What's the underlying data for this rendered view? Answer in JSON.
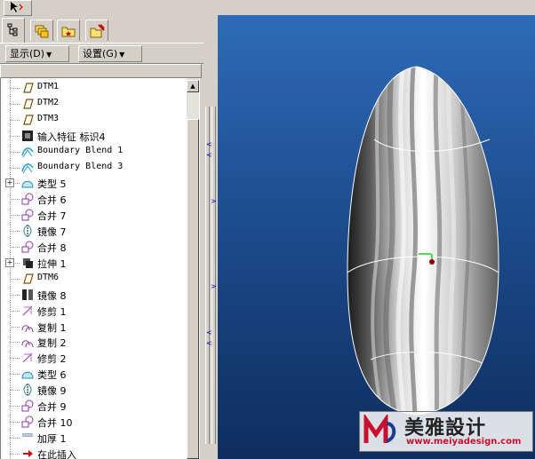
{
  "toolbar": {
    "select_icon": "arrow-select-icon"
  },
  "tabs": [
    {
      "icon": "model-tree-icon",
      "active": true
    },
    {
      "icon": "layers-icon",
      "active": false
    },
    {
      "icon": "folder-icon",
      "active": false
    },
    {
      "icon": "favorites-icon",
      "active": false
    }
  ],
  "menus": {
    "show_label": "显示",
    "show_key": "(D)",
    "settings_label": "设置",
    "settings_key": "(G)"
  },
  "tree": [
    {
      "label": "DTM1",
      "icon": "datum-plane-icon",
      "mono": true
    },
    {
      "label": "DTM2",
      "icon": "datum-plane-icon",
      "mono": true
    },
    {
      "label": "DTM3",
      "icon": "datum-plane-icon",
      "mono": true
    },
    {
      "label": "输入特征 标识4",
      "icon": "import-feature-icon",
      "mono": false
    },
    {
      "label": "Boundary Blend 1",
      "icon": "boundary-blend-icon",
      "mono": true
    },
    {
      "label": "Boundary Blend 3",
      "icon": "boundary-blend-icon",
      "mono": true
    },
    {
      "label": "类型 5",
      "icon": "surface-icon",
      "mono": false,
      "expandable": true
    },
    {
      "label": "合并 6",
      "icon": "merge-icon",
      "mono": false
    },
    {
      "label": "合并 7",
      "icon": "merge-icon",
      "mono": false
    },
    {
      "label": "镜像 7",
      "icon": "mirror-icon",
      "mono": false
    },
    {
      "label": "合并 8",
      "icon": "merge-icon",
      "mono": false
    },
    {
      "label": "拉伸 1",
      "icon": "extrude-icon",
      "mono": false,
      "expandable": true
    },
    {
      "label": "DTM6",
      "icon": "datum-plane-icon",
      "mono": true
    },
    {
      "label": "镜像 8",
      "icon": "mirror-solid-icon",
      "mono": false
    },
    {
      "label": "修剪 1",
      "icon": "trim-icon",
      "mono": false
    },
    {
      "label": "复制 1",
      "icon": "copy-icon",
      "mono": false
    },
    {
      "label": "复制 2",
      "icon": "copy-icon",
      "mono": false
    },
    {
      "label": "修剪 2",
      "icon": "trim-icon",
      "mono": false
    },
    {
      "label": "类型 6",
      "icon": "surface-icon",
      "mono": false
    },
    {
      "label": "镜像 9",
      "icon": "mirror-icon",
      "mono": false
    },
    {
      "label": "合并 9",
      "icon": "merge-icon",
      "mono": false
    },
    {
      "label": "合并 10",
      "icon": "merge-icon",
      "mono": false
    },
    {
      "label": "加厚 1",
      "icon": "thicken-icon",
      "mono": false
    },
    {
      "label": "在此插入",
      "icon": "insert-here-arrow-icon",
      "mono": false
    }
  ],
  "watermark": {
    "brand": "美雅設计",
    "url": "www.meiyadesign.com"
  },
  "colors": {
    "viewport_top": "#2e6bb8",
    "viewport_bottom": "#0e2d5e",
    "watermark_red": "#c8102e"
  }
}
